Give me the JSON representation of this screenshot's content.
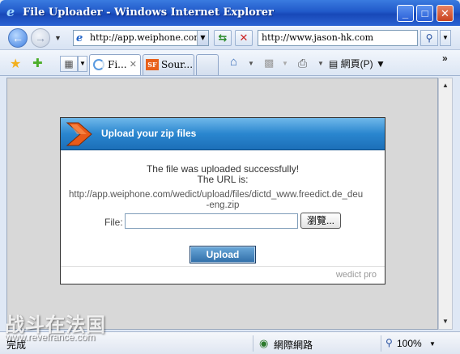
{
  "window": {
    "title": "File Uploader - Windows Internet Explorer",
    "min_label": "_",
    "max_label": "□",
    "close_label": "✕"
  },
  "addressbar": {
    "url": "http://app.weiphone.com/wedict/upload/",
    "search_value": "http://www.jason-hk.com"
  },
  "tabs": [
    {
      "label": "Fi...",
      "active": true
    },
    {
      "label": "Sour...",
      "active": false
    }
  ],
  "commandbar": {
    "page_label": "網頁(P)"
  },
  "dialog": {
    "header_title": "Upload your zip files",
    "message_line1": "The file was uploaded successfully!",
    "message_line2": "The URL is:",
    "uploaded_url": "http://app.weiphone.com/wedict/upload/files/dictd_www.freedict.de_deu",
    "uploaded_url_cont": "-eng.zip",
    "file_label": "File:",
    "file_value": "",
    "browse_label": "瀏覽...",
    "upload_label": "Upload",
    "brand": "wedict pro"
  },
  "statusbar": {
    "status": "完成",
    "zone": "網際網路",
    "zoom": "100%"
  },
  "watermark": {
    "cn": "战斗在法国",
    "url": "www.revefrance.com"
  },
  "colors": {
    "titlebar": "#2159c9",
    "dialog_header": "#2a86cf",
    "upload_button": "#2f6ea8",
    "chevron": "#e85a1a"
  }
}
